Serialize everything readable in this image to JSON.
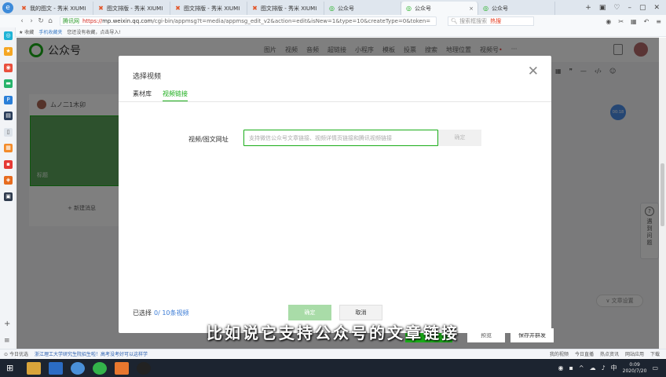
{
  "browser": {
    "tabs": [
      {
        "label": "我的图文 - 秀米 XIUMI",
        "icon": "xiumi-icon"
      },
      {
        "label": "图文排版 - 秀米 XIUMI",
        "icon": "xiumi-icon"
      },
      {
        "label": "图文排版 - 秀米 XIUMI",
        "icon": "xiumi-icon"
      },
      {
        "label": "图文排版 - 秀米 XIUMI",
        "icon": "xiumi-icon"
      },
      {
        "label": "公众号",
        "icon": "wechat-mp-icon"
      },
      {
        "label": "公众号",
        "icon": "wechat-mp-icon",
        "active": true
      },
      {
        "label": "公众号",
        "icon": "wechat-mp-icon"
      }
    ],
    "address": {
      "badge": "腾讯网",
      "https": "https://",
      "host": "mp.weixin.qq.com",
      "path": "/cgi-bin/appmsg?t=media/appmsg_edit_v2&action=edit&isNew=1&type=10&createType=0&token="
    },
    "search_placeholder": "搜索框搜索",
    "hot_label": "热搜",
    "favorites": {
      "collect": "收藏",
      "phone_fav": "手机收藏夹",
      "hint": "您还没有收藏，点击导入!"
    },
    "status": {
      "left": "今日优选",
      "news": "浙江理工大学研究生院招生啦！高考没考好可以这样学",
      "right": [
        "我的视频",
        "今日直播",
        "热点资讯",
        "网站应用",
        "下载"
      ]
    }
  },
  "mp": {
    "logo_text": "公众号",
    "menu": [
      "图片",
      "视频",
      "音频",
      "超链接",
      "小程序",
      "模板",
      "投票",
      "搜索",
      "地理位置",
      "视频号",
      "···"
    ],
    "author": "ムノ二1木卯",
    "cover_title": "标题",
    "new_message": "+ 新建消息",
    "assist_dot": "00:18",
    "help_text": "遇到问题",
    "article_settings": "文章设置",
    "bottom_buttons": [
      "预览",
      "保存并群发"
    ]
  },
  "modal": {
    "title": "选择视频",
    "tabs": [
      "素材库",
      "视频链接"
    ],
    "active_tab": 1,
    "field_label": "视频/图文网址",
    "input_placeholder": "支持微信公众号文章链接、视频详情页链接和腾讯视频链接",
    "confirm_small": "确定",
    "selected_prefix": "已选择",
    "selected_count": "0/ 10条视频",
    "ok_button": "确定",
    "cancel_button": "取消"
  },
  "subtitle": "比如说它支持公众号的文章链接",
  "taskbar": {
    "time": "0:09",
    "date": "2020/7/20",
    "lang": "中"
  },
  "colors": {
    "accent": "#1aad19",
    "link": "#3a7bd5"
  }
}
